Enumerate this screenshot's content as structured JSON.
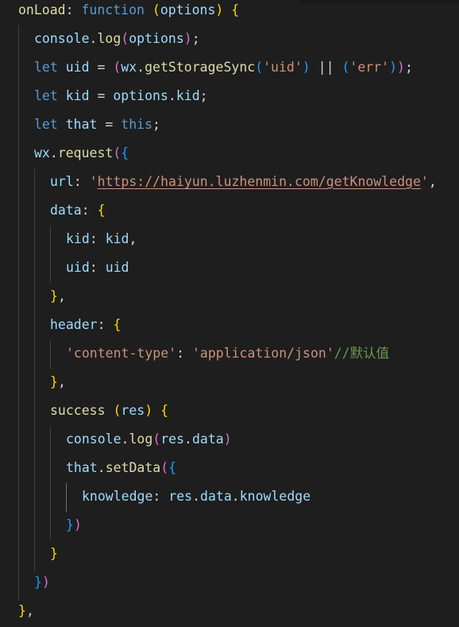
{
  "editor": {
    "theme_colors": {
      "background": "#1e1e1e",
      "keyword": "#569cd6",
      "function": "#dcdcaa",
      "variable": "#9cdcfe",
      "string": "#ce9178",
      "comment": "#6a9955",
      "bracket_level1": "#ffd700",
      "bracket_level2": "#da70d6",
      "bracket_level3": "#179fff"
    },
    "code": {
      "l1_onLoad": "onLoad",
      "l1_colon": ": ",
      "l1_function": "function",
      "l1_space": " ",
      "l1_open_paren": "(",
      "l1_options": "options",
      "l1_close_paren": ")",
      "l1_space2": " ",
      "l1_open_brace": "{",
      "l2_console": "console",
      "l2_dot": ".",
      "l2_log": "log",
      "l2_open": "(",
      "l2_options": "options",
      "l2_close": ")",
      "l2_semi": ";",
      "l3_let": "let",
      "l3_uid": " uid ",
      "l3_eq": "= ",
      "l3_open1": "(",
      "l3_wx": "wx",
      "l3_dot": ".",
      "l3_getStorageSync": "getStorageSync",
      "l3_open2": "(",
      "l3_uid_str": "'uid'",
      "l3_close2": ")",
      "l3_or": " || ",
      "l3_open3": "(",
      "l3_err_str": "'err'",
      "l3_close3": ")",
      "l3_close1": ")",
      "l3_semi": ";",
      "l4_let": "let",
      "l4_kid": " kid ",
      "l4_eq": "= ",
      "l4_options": "options",
      "l4_dot": ".",
      "l4_prop": "kid",
      "l4_semi": ";",
      "l5_let": "let",
      "l5_that": " that ",
      "l5_eq": "= ",
      "l5_this": "this",
      "l5_semi": ";",
      "l6_wx": "wx",
      "l6_dot": ".",
      "l6_request": "request",
      "l6_open": "(",
      "l6_brace": "{",
      "l7_url": "url",
      "l7_colon": ": ",
      "l7_q1": "'",
      "l7_link": "https://haiyun.luzhenmin.com/getKnowledge",
      "l7_q2": "'",
      "l7_comma": ",",
      "l8_data": "data",
      "l8_colon": ": ",
      "l8_brace": "{",
      "l9_kid": "kid",
      "l9_colon": ": ",
      "l9_kidval": "kid",
      "l9_comma": ",",
      "l10_uid": "uid",
      "l10_colon": ": ",
      "l10_uidval": "uid",
      "l11_brace": "}",
      "l11_comma": ",",
      "l12_header": "header",
      "l12_colon": ": ",
      "l12_brace": "{",
      "l13_key": "'content-type'",
      "l13_colon": ": ",
      "l13_val": "'application/json'",
      "l13_comment": "//默认值",
      "l14_brace": "}",
      "l14_comma": ",",
      "l15_success": "success",
      "l15_space": " ",
      "l15_open": "(",
      "l15_res": "res",
      "l15_close": ")",
      "l15_space2": " ",
      "l15_brace": "{",
      "l16_console": "console",
      "l16_dot": ".",
      "l16_log": "log",
      "l16_open": "(",
      "l16_res": "res",
      "l16_dot2": ".",
      "l16_data": "data",
      "l16_close": ")",
      "l17_that": "that",
      "l17_dot": ".",
      "l17_setData": "setData",
      "l17_open": "(",
      "l17_brace": "{",
      "l18_knowledge": "knowledge",
      "l18_colon": ": ",
      "l18_res": "res",
      "l18_dot": ".",
      "l18_data": "data",
      "l18_dot2": ".",
      "l18_knowledge2": "knowledge",
      "l19_brace": "}",
      "l19_close": ")",
      "l20_brace": "}",
      "l21_close": ")",
      "l21_brace": "}",
      "l22_brace": "}",
      "l22_comma": ","
    }
  }
}
